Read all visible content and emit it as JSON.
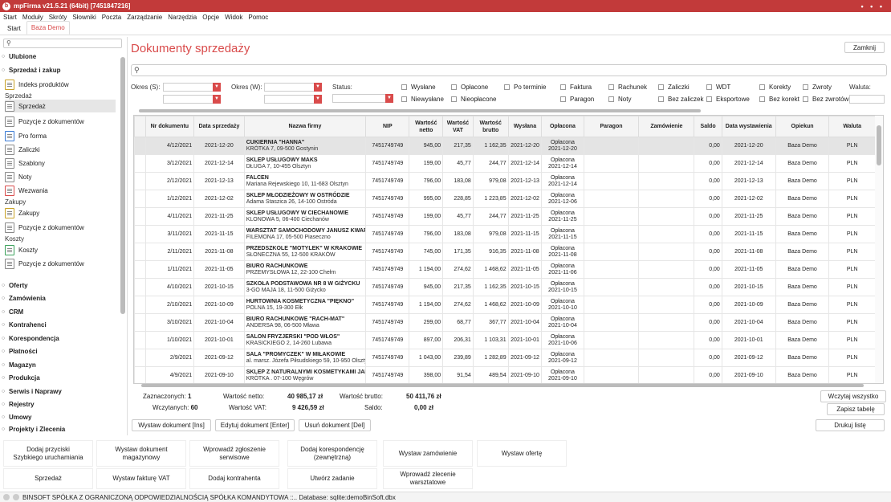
{
  "window": {
    "title": "mpFirma v21.5.21 (64bit) [7451847216]",
    "controls": "• • •"
  },
  "menu": [
    "Start",
    "Moduły",
    "Skróty",
    "Słowniki",
    "Poczta",
    "Zarządzanie",
    "Narzędzia",
    "Opcje",
    "Widok",
    "Pomoc"
  ],
  "tabs": [
    "Start",
    "Baza Demo"
  ],
  "sidebar": {
    "groups": {
      "ulubione": "Ulubione",
      "sprzedaz_zakup": "Sprzedaż i zakup"
    },
    "indeks": "Indeks produktów",
    "sub_sprzedaz": "Sprzedaż",
    "sprzedaz_items": [
      "Sprzedaż",
      "Pozycje z dokumentów",
      "Pro forma",
      "Zaliczki",
      "Szablony",
      "Noty",
      "Wezwania"
    ],
    "sub_zakupy": "Zakupy",
    "zakupy_items": [
      "Zakupy",
      "Pozycje z dokumentów"
    ],
    "sub_koszty": "Koszty",
    "koszty_items": [
      "Koszty",
      "Pozycje z dokumentów"
    ],
    "more_groups": [
      "Oferty",
      "Zamówienia",
      "CRM",
      "Kontrahenci",
      "Korespondencja",
      "Płatności",
      "Magazyn",
      "Produkcja",
      "Serwis i Naprawy",
      "Rejestry",
      "Umowy",
      "Projekty i Zlecenia"
    ]
  },
  "page": {
    "title": "Dokumenty sprzedaży",
    "close": "Zamknij"
  },
  "filters": {
    "okres_s": "Okres (S):",
    "okres_w": "Okres (W):",
    "status": "Status:",
    "checks": [
      "Wysłane",
      "Opłacone",
      "Po terminie",
      "Faktura",
      "Rachunek",
      "Zaliczki",
      "WDT",
      "Korekty",
      "Zwroty",
      "Niewysłane",
      "Nieopłacone",
      "Paragon",
      "Noty",
      "Bez zaliczek",
      "Eksportowe",
      "Bez korekt",
      "Bez zwrotów"
    ],
    "waluta": "Waluta:"
  },
  "table": {
    "headers": [
      "Nr dokumentu",
      "Data sprzedaży",
      "Nazwa firmy",
      "NIP",
      "Wartość netto",
      "Wartość VAT",
      "Wartość brutto",
      "Wysłana",
      "Opłacona",
      "Paragon",
      "Zamówienie",
      "Saldo",
      "Data wystawienia",
      "Opiekun",
      "Waluta"
    ],
    "rows": [
      {
        "nr": "4/12/2021",
        "ds": "2021-12-20",
        "name": "CUKIERNIA \"HANNA\"",
        "addr": "KRÓTKA 7, 09-500 Gostynin",
        "nip": "7451749749",
        "netto": "945,00",
        "vat": "217,35",
        "brutto": "1 162,35",
        "wys": "2021-12-20",
        "opl1": "Opłacona",
        "opl2": "2021-12-20",
        "saldo": "0,00",
        "dw": "2021-12-20",
        "op": "Baza Demo",
        "wal": "PLN"
      },
      {
        "nr": "3/12/2021",
        "ds": "2021-12-14",
        "name": "SKLEP USŁUGOWY MAKS",
        "addr": "DŁUGA 7, 10-455 Olsztyn",
        "nip": "7451749749",
        "netto": "199,00",
        "vat": "45,77",
        "brutto": "244,77",
        "wys": "2021-12-14",
        "opl1": "Opłacona",
        "opl2": "2021-12-14",
        "saldo": "0,00",
        "dw": "2021-12-14",
        "op": "Baza Demo",
        "wal": "PLN"
      },
      {
        "nr": "2/12/2021",
        "ds": "2021-12-13",
        "name": "FALCEN",
        "addr": "Mariana Rejewskiego 10, 11-683 Olsztyn",
        "nip": "7451749749",
        "netto": "796,00",
        "vat": "183,08",
        "brutto": "979,08",
        "wys": "2021-12-13",
        "opl1": "Opłacona",
        "opl2": "2021-12-14",
        "saldo": "0,00",
        "dw": "2021-12-13",
        "op": "Baza Demo",
        "wal": "PLN"
      },
      {
        "nr": "1/12/2021",
        "ds": "2021-12-02",
        "name": "SKLEP MŁODZIEŻOWY W OSTRÓDZIE",
        "addr": "Adama Staszica 26, 14-100 Ostróda",
        "nip": "7451749749",
        "netto": "995,00",
        "vat": "228,85",
        "brutto": "1 223,85",
        "wys": "2021-12-02",
        "opl1": "Opłacona",
        "opl2": "2021-12-06",
        "saldo": "0,00",
        "dw": "2021-12-02",
        "op": "Baza Demo",
        "wal": "PLN"
      },
      {
        "nr": "4/11/2021",
        "ds": "2021-11-25",
        "name": "SKLEP USŁUGOWY W CIECHANOWIE",
        "addr": "KLONOWA 5, 06-400 Ciechanów",
        "nip": "7451749749",
        "netto": "199,00",
        "vat": "45,77",
        "brutto": "244,77",
        "wys": "2021-11-25",
        "opl1": "Opłacona",
        "opl2": "2021-11-25",
        "saldo": "0,00",
        "dw": "2021-11-25",
        "op": "Baza Demo",
        "wal": "PLN"
      },
      {
        "nr": "3/11/2021",
        "ds": "2021-11-15",
        "name": "WARSZTAT SAMOCHODOWY JANUSZ KWARC",
        "addr": "FILEMONA 17, 05-500 Piaseczno",
        "nip": "7451749749",
        "netto": "796,00",
        "vat": "183,08",
        "brutto": "979,08",
        "wys": "2021-11-15",
        "opl1": "Opłacona",
        "opl2": "2021-11-15",
        "saldo": "0,00",
        "dw": "2021-11-15",
        "op": "Baza Demo",
        "wal": "PLN"
      },
      {
        "nr": "2/11/2021",
        "ds": "2021-11-08",
        "name": "PRZEDSZKOLE \"MOTYLEK\" W KRAKOWIE",
        "addr": "SŁONECZNA 55, 12-500 KRAKÓW",
        "nip": "7451749749",
        "netto": "745,00",
        "vat": "171,35",
        "brutto": "916,35",
        "wys": "2021-11-08",
        "opl1": "Opłacona",
        "opl2": "2021-11-08",
        "saldo": "0,00",
        "dw": "2021-11-08",
        "op": "Baza Demo",
        "wal": "PLN"
      },
      {
        "nr": "1/11/2021",
        "ds": "2021-11-05",
        "name": "BIURO RACHUNKOWE",
        "addr": "PRZEMYSŁOWA 12, 22-100 Chełm",
        "nip": "7451749749",
        "netto": "1 194,00",
        "vat": "274,62",
        "brutto": "1 468,62",
        "wys": "2021-11-05",
        "opl1": "Opłacona",
        "opl2": "2021-11-06",
        "saldo": "0,00",
        "dw": "2021-11-05",
        "op": "Baza Demo",
        "wal": "PLN"
      },
      {
        "nr": "4/10/2021",
        "ds": "2021-10-15",
        "name": "SZKOŁA PODSTAWOWA NR 8 W GIŻYCKU",
        "addr": "3-GO MAJA 18, 11-500 Giżycko",
        "nip": "7451749749",
        "netto": "945,00",
        "vat": "217,35",
        "brutto": "1 162,35",
        "wys": "2021-10-15",
        "opl1": "Opłacona",
        "opl2": "2021-10-15",
        "saldo": "0,00",
        "dw": "2021-10-15",
        "op": "Baza Demo",
        "wal": "PLN"
      },
      {
        "nr": "2/10/2021",
        "ds": "2021-10-09",
        "name": "HURTOWNIA KOSMETYCZNA \"PIĘKNO\"",
        "addr": "POLNA 15, 19-300 Ełk",
        "nip": "7451749749",
        "netto": "1 194,00",
        "vat": "274,62",
        "brutto": "1 468,62",
        "wys": "2021-10-09",
        "opl1": "Opłacona",
        "opl2": "2021-10-10",
        "saldo": "0,00",
        "dw": "2021-10-09",
        "op": "Baza Demo",
        "wal": "PLN"
      },
      {
        "nr": "3/10/2021",
        "ds": "2021-10-04",
        "name": "BIURO RACHUNKOWE \"RACH-MAT\"",
        "addr": "ANDERSA 98, 06-500 Mława",
        "nip": "7451749749",
        "netto": "299,00",
        "vat": "68,77",
        "brutto": "367,77",
        "wys": "2021-10-04",
        "opl1": "Opłacona",
        "opl2": "2021-10-04",
        "saldo": "0,00",
        "dw": "2021-10-04",
        "op": "Baza Demo",
        "wal": "PLN"
      },
      {
        "nr": "1/10/2021",
        "ds": "2021-10-01",
        "name": "SALON FRYZJERSKI \"POD WŁOS\"",
        "addr": "KRASICKIEGO 2, 14-260 Lubawa",
        "nip": "7451749749",
        "netto": "897,00",
        "vat": "206,31",
        "brutto": "1 103,31",
        "wys": "2021-10-01",
        "opl1": "Opłacona",
        "opl2": "2021-10-06",
        "saldo": "0,00",
        "dw": "2021-10-01",
        "op": "Baza Demo",
        "wal": "PLN"
      },
      {
        "nr": "2/9/2021",
        "ds": "2021-09-12",
        "name": "SALA \"PROMYCZEK\" W MIŁAKOWIE",
        "addr": "al. marsz. Józefa Piłsudskiego 59, 10-950 Olsztyn",
        "nip": "7451749749",
        "netto": "1 043,00",
        "vat": "239,89",
        "brutto": "1 282,89",
        "wys": "2021-09-12",
        "opl1": "Opłacona",
        "opl2": "2021-09-12",
        "saldo": "0,00",
        "dw": "2021-09-12",
        "op": "Baza Demo",
        "wal": "PLN"
      },
      {
        "nr": "4/9/2021",
        "ds": "2021-09-10",
        "name": "SKLEP Z NATURALNYMI KOSMETYKAMI JADWIGA",
        "addr": "KRÓTKA . 07-100 Węgrów",
        "nip": "7451749749",
        "netto": "398,00",
        "vat": "91,54",
        "brutto": "489,54",
        "wys": "2021-09-10",
        "opl1": "Opłacona",
        "opl2": "2021-09-10",
        "saldo": "0,00",
        "dw": "2021-09-10",
        "op": "Baza Demo",
        "wal": "PLN"
      }
    ]
  },
  "summary": {
    "zaznaczonych_l": "Zaznaczonych:",
    "zaznaczonych_v": "1",
    "wczytanych_l": "Wczytanych:",
    "wczytanych_v": "60",
    "netto_l": "Wartość netto:",
    "netto_v": "40 985,17 zł",
    "vat_l": "Wartość VAT:",
    "vat_v": "9 426,59 zł",
    "brutto_l": "Wartość brutto:",
    "brutto_v": "50 411,76 zł",
    "saldo_l": "Saldo:",
    "saldo_v": "0,00 zł",
    "load_all": "Wczytaj wszystko",
    "save_table": "Zapisz tabelę",
    "print": "Drukuj listę"
  },
  "actions": {
    "issue": "Wystaw dokument [Ins]",
    "edit": "Edytuj dokument [Enter]",
    "delete": "Usuń dokument [Del]"
  },
  "quick": [
    [
      "Dodaj przyciski",
      "Szybkiego uruchamiania"
    ],
    [
      "Wystaw dokument",
      "magazynowy"
    ],
    [
      "Wprowadź zgłoszenie",
      "serwisowe"
    ],
    [
      "Dodaj korespondencję",
      "(zewnętrzną)"
    ],
    [
      "Wystaw zamówienie",
      ""
    ],
    [
      "Wystaw ofertę",
      ""
    ],
    [
      "Sprzedaż",
      ""
    ],
    [
      "Wystaw fakturę VAT",
      ""
    ],
    [
      "Dodaj kontrahenta",
      ""
    ],
    [
      "Utwórz zadanie",
      ""
    ],
    [
      "Wprowadź zlecenie",
      "warsztatowe"
    ]
  ],
  "status": "BINSOFT SPÓŁKA Z OGRANICZONĄ ODPOWIEDZIALNOŚCIĄ SPÓŁKA KOMANDYTOWA ::.. Database: sqlite:demoBinSoft.dbx"
}
